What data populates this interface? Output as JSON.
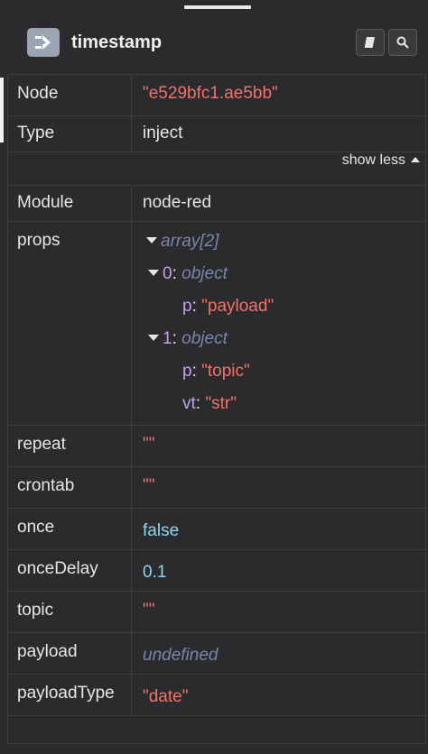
{
  "header": {
    "title": "timestamp"
  },
  "rows_top": [
    {
      "key": "Node",
      "value": "\"e529bfc1.ae5bb\""
    },
    {
      "key": "Type",
      "value": "inject"
    }
  ],
  "show_less_label": "show less",
  "module": {
    "key": "Module",
    "value": "node-red"
  },
  "props": {
    "key": "props",
    "root": "array[2]",
    "items": [
      {
        "index": "0",
        "type": "object",
        "fields": [
          {
            "k": "p",
            "v": "\"payload\""
          }
        ]
      },
      {
        "index": "1",
        "type": "object",
        "fields": [
          {
            "k": "p",
            "v": "\"topic\""
          },
          {
            "k": "vt",
            "v": "\"str\""
          }
        ]
      }
    ]
  },
  "rows_bottom": [
    {
      "key": "repeat",
      "value": "\"\""
    },
    {
      "key": "crontab",
      "value": "\"\""
    },
    {
      "key": "once",
      "value": "false"
    },
    {
      "key": "onceDelay",
      "value": "0.1"
    },
    {
      "key": "topic",
      "value": "\"\""
    },
    {
      "key": "payload",
      "value": "undefined"
    },
    {
      "key": "payloadType",
      "value": "\"date\""
    }
  ],
  "colors": {
    "string": "#f2726a",
    "boolean": "#8dd4f0",
    "undefined": "#7a86a8",
    "property": "#c3a0ef"
  }
}
